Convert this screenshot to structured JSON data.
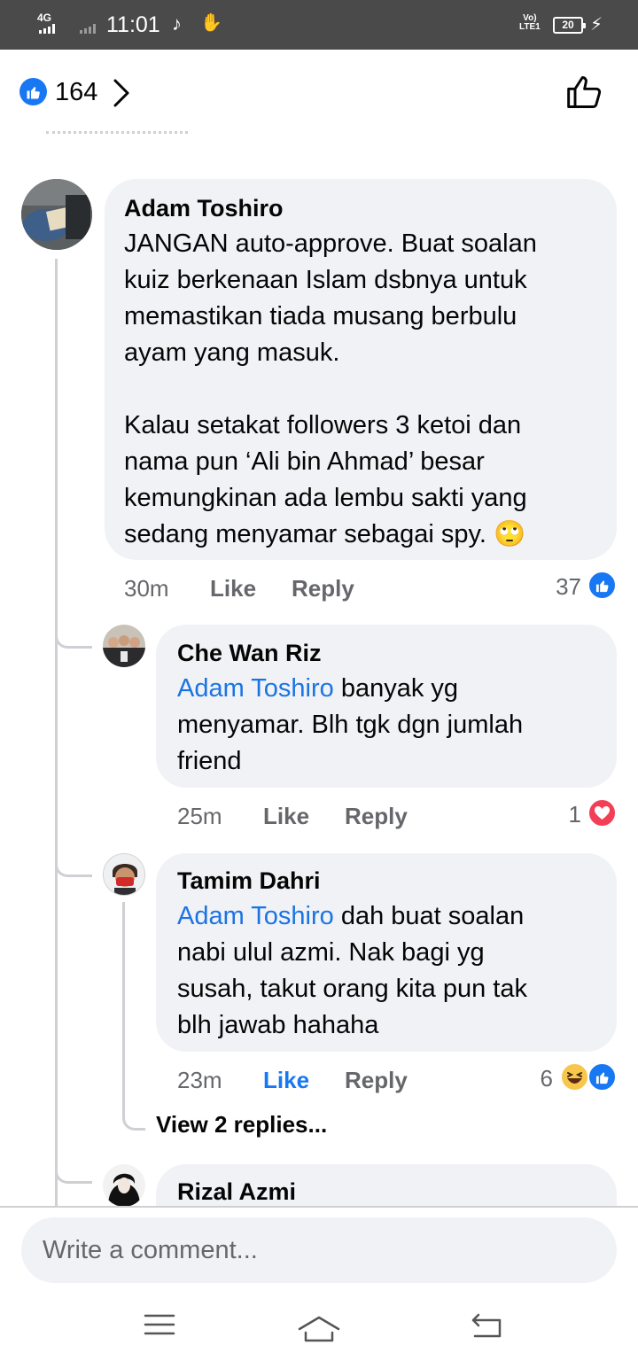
{
  "status_bar": {
    "network": "4G",
    "time": "11:01",
    "volte": "Vo)) LTE1",
    "battery": "20",
    "icons": [
      "signal-icon",
      "tiktok-icon",
      "hand-icon",
      "charging-icon"
    ]
  },
  "header": {
    "reaction_count": "164",
    "icons": [
      "like-reaction-icon",
      "chevron-right-icon",
      "thumbs-up-outline-icon"
    ]
  },
  "comments": [
    {
      "author": "Adam Toshiro",
      "lines": [
        "JANGAN auto-approve. Buat soalan",
        "kuiz berkenaan Islam dsbnya untuk",
        "memastikan tiada musang berbulu",
        "ayam yang masuk.",
        "",
        "Kalau setakat followers 3 ketoi dan",
        "nama pun ‘Ali bin Ahmad’ besar",
        "kemungkinan ada lembu sakti yang",
        "sedang menyamar sebagai spy. 🙄"
      ],
      "time": "30m",
      "like_label": "Like",
      "reply_label": "Reply",
      "reaction_count": "37",
      "reactions": [
        "like"
      ]
    },
    {
      "author": "Che Wan Riz",
      "mention": "Adam Toshiro",
      "lines": [
        " banyak yg",
        "menyamar. Blh tgk dgn jumlah",
        "friend"
      ],
      "time": "25m",
      "like_label": "Like",
      "reply_label": "Reply",
      "reaction_count": "1",
      "reactions": [
        "love"
      ]
    },
    {
      "author": "Tamim Dahri",
      "mention": "Adam Toshiro",
      "lines": [
        " dah buat soalan",
        "nabi ulul azmi. Nak bagi yg",
        "susah, takut orang kita pun tak",
        "blh jawab hahaha"
      ],
      "time": "23m",
      "like_label": "Like",
      "like_active": true,
      "reply_label": "Reply",
      "reaction_count": "6",
      "reactions": [
        "haha",
        "like"
      ],
      "view_replies": "View 2 replies..."
    },
    {
      "author": "Rizal Azmi"
    }
  ],
  "composer": {
    "placeholder": "Write a comment..."
  },
  "nav": {
    "icons": [
      "menu-icon",
      "home-icon",
      "back-icon"
    ]
  },
  "colors": {
    "accent": "#1877f2",
    "bubble": "#f0f2f5",
    "meta_text": "#65676b",
    "love": "#f33e58",
    "haha": "#f7c64b",
    "status_bar": "#4a4a4a"
  }
}
